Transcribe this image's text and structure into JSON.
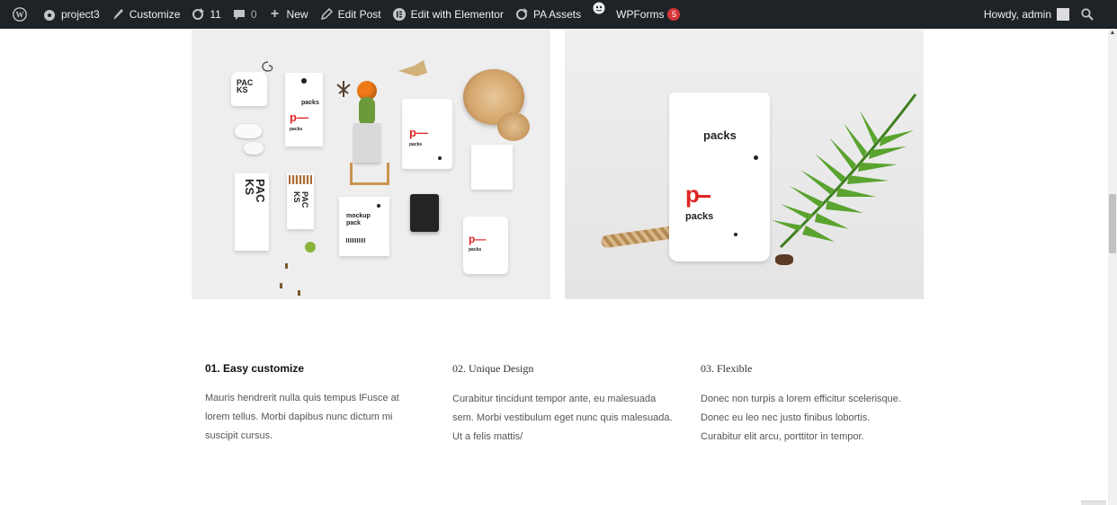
{
  "adminbar": {
    "site_name": "project3",
    "customize": "Customize",
    "updates_count": "11",
    "comments_count": "0",
    "new_label": "New",
    "edit_post": "Edit Post",
    "edit_elementor": "Edit with Elementor",
    "pa_assets": "PA Assets",
    "wpforms": "WPForms",
    "wpforms_badge": "5",
    "howdy": "Howdy, admin"
  },
  "hero_left": {
    "pack_small_top": "PAC\nKS",
    "pack_tag_text": "packs",
    "pack_tag_p": "p—",
    "pack_tag_sub": "packs",
    "pack_big_vertical": "PAC\nKS",
    "pack_matches": "PAC\nKS",
    "pouch_p": "p—",
    "pouch_sub": "packs",
    "mockup_title": "mockup\npack",
    "jar_p": "p—",
    "jar_sub": "packs"
  },
  "hero_right": {
    "pouch_title": "packs",
    "pouch_p": "p",
    "pouch_sub": "packs"
  },
  "features": [
    {
      "title": "01. Easy customize",
      "text": "Mauris hendrerit nulla quis tempus lFusce at lorem tellus. Morbi dapibus nunc dictum mi suscipit cursus."
    },
    {
      "title": "02. Unique Design",
      "text": "Curabitur tincidunt tempor ante, eu malesuada sem. Morbi vestibulum eget nunc quis malesuada. Ut a felis mattis/"
    },
    {
      "title": "03. Flexible",
      "text": "Donec non turpis a lorem efficitur scelerisque. Donec eu leo nec justo finibus lobortis. Curabitur elit arcu, porttitor in tempor."
    }
  ],
  "colors": {
    "adminbar_bg": "#1d2327",
    "badge": "#d63638",
    "brand_red": "#e02424",
    "fern_green": "#4f9a2a"
  }
}
